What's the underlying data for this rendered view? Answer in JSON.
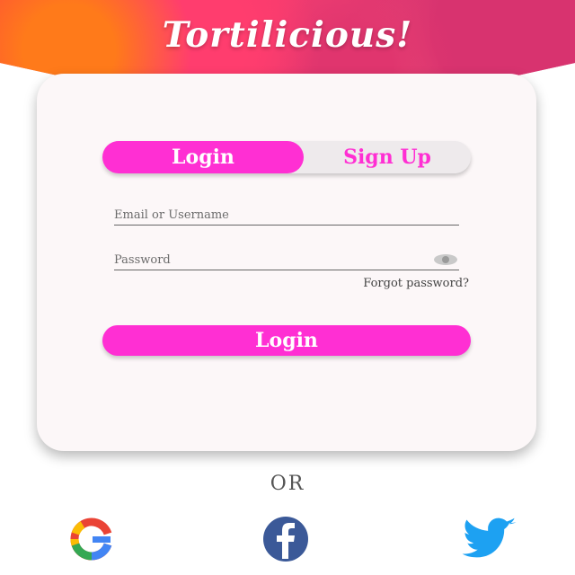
{
  "app": {
    "title": "Tortilicious!"
  },
  "auth_toggle": {
    "login_label": "Login",
    "signup_label": "Sign Up",
    "active": "login"
  },
  "form": {
    "email_placeholder": "Email or Username",
    "email_value": "",
    "password_placeholder": "Password",
    "password_value": "",
    "forgot_label": "Forgot password?",
    "submit_label": "Login"
  },
  "divider": {
    "label": "OR"
  },
  "social": {
    "items": [
      {
        "name": "google",
        "icon": "google-icon"
      },
      {
        "name": "facebook",
        "icon": "facebook-icon"
      },
      {
        "name": "twitter",
        "icon": "twitter-icon"
      }
    ]
  },
  "colors": {
    "accent": "#ff2fd3",
    "card_bg": "#fcf7f8",
    "toggle_bg": "#eeeaec",
    "facebook_blue": "#3b5998",
    "twitter_blue": "#1da1f2"
  }
}
